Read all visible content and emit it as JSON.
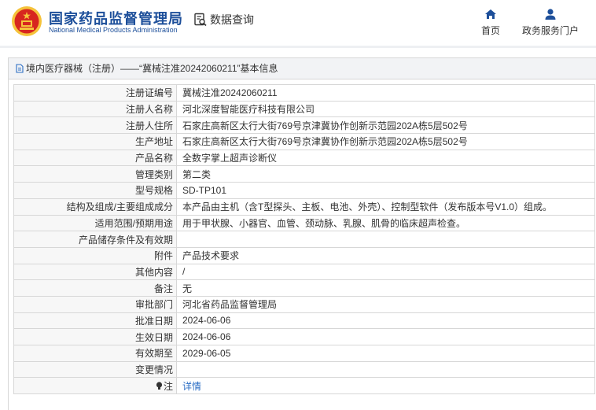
{
  "header": {
    "brand_cn": "国家药品监督管理局",
    "brand_en": "National Medical Products Administration",
    "query_label": "数据查询",
    "nav": [
      {
        "label": "首页",
        "icon": "home-icon"
      },
      {
        "label": "政务服务门户",
        "icon": "user-icon"
      }
    ]
  },
  "panel": {
    "title": "境内医疗器械（注册）——“冀械注准20242060211”基本信息"
  },
  "rows": [
    {
      "label": "注册证编号",
      "value": "冀械注准20242060211"
    },
    {
      "label": "注册人名称",
      "value": "河北深度智能医疗科技有限公司"
    },
    {
      "label": "注册人住所",
      "value": "石家庄高新区太行大街769号京津冀协作创新示范园202A栋5层502号"
    },
    {
      "label": "生产地址",
      "value": "石家庄高新区太行大街769号京津冀协作创新示范园202A栋5层502号"
    },
    {
      "label": "产品名称",
      "value": "全数字掌上超声诊断仪"
    },
    {
      "label": "管理类别",
      "value": "第二类"
    },
    {
      "label": "型号规格",
      "value": "SD-TP101"
    },
    {
      "label": "结构及组成/主要组成成分",
      "value": "本产品由主机（含T型探头、主板、电池、外壳）、控制型软件（发布版本号V1.0）组成。"
    },
    {
      "label": "适用范围/预期用途",
      "value": "用于甲状腺、小器官、血管、颈动脉、乳腺、肌骨的临床超声检查。"
    },
    {
      "label": "产品储存条件及有效期",
      "value": ""
    },
    {
      "label": "附件",
      "value": "产品技术要求"
    },
    {
      "label": "其他内容",
      "value": "/"
    },
    {
      "label": "备注",
      "value": "无"
    },
    {
      "label": "审批部门",
      "value": "河北省药品监督管理局"
    },
    {
      "label": "批准日期",
      "value": "2024-06-06"
    },
    {
      "label": "生效日期",
      "value": "2024-06-06"
    },
    {
      "label": "有效期至",
      "value": "2029-06-05"
    },
    {
      "label": "变更情况",
      "value": ""
    }
  ],
  "note_row": {
    "label": "注",
    "link": "详情",
    "icon": "lightbulb-icon"
  },
  "colors": {
    "brand": "#1d4f9a",
    "link": "#2a6dc4",
    "emblem_red": "#d7261f",
    "emblem_gold": "#f5c33b"
  }
}
